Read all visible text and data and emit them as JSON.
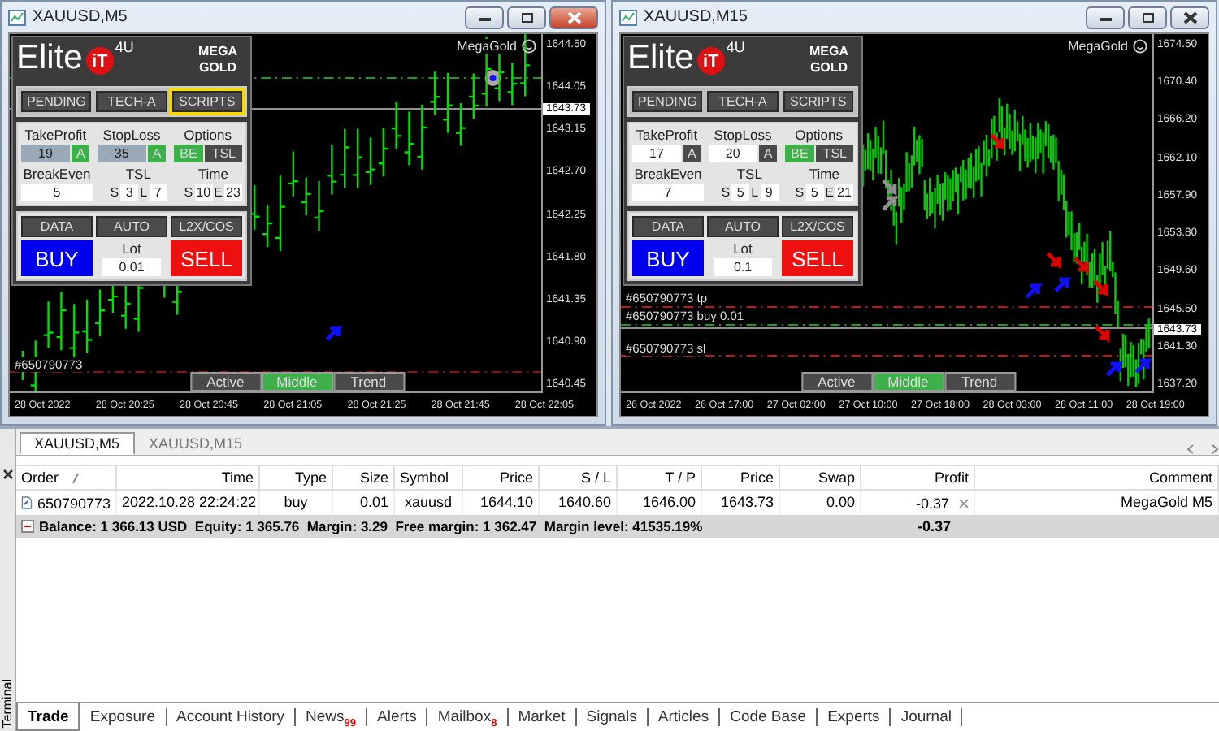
{
  "charts": [
    {
      "title": "XAUUSD,M5",
      "active": true,
      "panel": {
        "logo": {
          "word": "Elite",
          "badge": "iT",
          "suffix": "4U",
          "brand": [
            "MEGA",
            "GOLD"
          ]
        },
        "menu_buttons": [
          {
            "label": "PENDING",
            "highlighted": false
          },
          {
            "label": "TECH-A",
            "highlighted": false
          },
          {
            "label": "SCRIPTS",
            "highlighted": true
          }
        ],
        "take_profit": {
          "label": "TakeProfit",
          "value": "19",
          "auto": "A",
          "auto_on": true
        },
        "stop_loss": {
          "label": "StopLoss",
          "value": "35",
          "auto": "A",
          "auto_on": true
        },
        "options": {
          "label": "Options",
          "buttons": [
            {
              "label": "BE",
              "on": true
            },
            {
              "label": "TSL",
              "on": false
            }
          ]
        },
        "break_even": {
          "label": "BreakEven",
          "value": "5"
        },
        "tsl": {
          "label": "TSL",
          "fields": [
            {
              "prefix": "S",
              "value": "3"
            },
            {
              "prefix": "L",
              "value": "7"
            }
          ]
        },
        "time": {
          "label": "Time",
          "fields": [
            {
              "prefix": "S",
              "value": "10"
            },
            {
              "prefix": "E",
              "value": "23"
            }
          ]
        },
        "tool_buttons": [
          "DATA",
          "AUTO",
          "L2X/COS"
        ],
        "buy": "BUY",
        "lot": {
          "label": "Lot",
          "value": "0.01"
        },
        "sell": "SELL"
      },
      "watermark": "MegaGold",
      "order_lines": [
        {
          "label": "#650790773",
          "kind": "sl"
        }
      ],
      "current_price": "1643.73",
      "price_ticks": [
        "1644.50",
        "1644.05",
        "1643.15",
        "1642.70",
        "1642.25",
        "1641.80",
        "1641.35",
        "1640.90",
        "1640.45"
      ],
      "time_ticks": [
        "28 Oct 2022",
        "28 Oct 20:25",
        "28 Oct 20:45",
        "28 Oct 21:05",
        "28 Oct 21:25",
        "28 Oct 21:45",
        "28 Oct 22:05"
      ],
      "trend_tabs": [
        {
          "label": "Active",
          "selected": false
        },
        {
          "label": "Middle",
          "selected": true
        },
        {
          "label": "Trend",
          "selected": false
        }
      ]
    },
    {
      "title": "XAUUSD,M15",
      "active": false,
      "panel": {
        "logo": {
          "word": "Elite",
          "badge": "iT",
          "suffix": "4U",
          "brand": [
            "MEGA",
            "GOLD"
          ]
        },
        "menu_buttons": [
          {
            "label": "PENDING",
            "highlighted": false
          },
          {
            "label": "TECH-A",
            "highlighted": false
          },
          {
            "label": "SCRIPTS",
            "highlighted": false
          }
        ],
        "take_profit": {
          "label": "TakeProfit",
          "value": "17",
          "auto": "A",
          "auto_on": false
        },
        "stop_loss": {
          "label": "StopLoss",
          "value": "20",
          "auto": "A",
          "auto_on": false
        },
        "options": {
          "label": "Options",
          "buttons": [
            {
              "label": "BE",
              "on": true
            },
            {
              "label": "TSL",
              "on": false
            }
          ]
        },
        "break_even": {
          "label": "BreakEven",
          "value": "7"
        },
        "tsl": {
          "label": "TSL",
          "fields": [
            {
              "prefix": "S",
              "value": "5"
            },
            {
              "prefix": "L",
              "value": "9"
            }
          ]
        },
        "time": {
          "label": "Time",
          "fields": [
            {
              "prefix": "S",
              "value": "5"
            },
            {
              "prefix": "E",
              "value": "21"
            }
          ]
        },
        "tool_buttons": [
          "DATA",
          "AUTO",
          "L2X/COS"
        ],
        "buy": "BUY",
        "lot": {
          "label": "Lot",
          "value": "0.1"
        },
        "sell": "SELL"
      },
      "watermark": "MegaGold",
      "order_lines": [
        {
          "label": "#650790773 tp",
          "kind": "tp"
        },
        {
          "label": "#650790773 buy 0.01",
          "kind": "open"
        },
        {
          "label": "#650790773 sl",
          "kind": "sl"
        }
      ],
      "current_price": "1643.73",
      "price_ticks": [
        "1674.50",
        "1670.40",
        "1666.20",
        "1662.10",
        "1657.90",
        "1653.80",
        "1649.60",
        "1645.50",
        "1641.30",
        "1637.20"
      ],
      "time_ticks": [
        "26 Oct 2022",
        "26 Oct 17:00",
        "27 Oct 02:00",
        "27 Oct 10:00",
        "27 Oct 18:00",
        "28 Oct 03:00",
        "28 Oct 11:00",
        "28 Oct 19:00"
      ],
      "trend_tabs": [
        {
          "label": "Active",
          "selected": false
        },
        {
          "label": "Middle",
          "selected": true
        },
        {
          "label": "Trend",
          "selected": false
        }
      ]
    }
  ],
  "chart_tabs": [
    {
      "label": "XAUUSD,M5",
      "selected": true
    },
    {
      "label": "XAUUSD,M15",
      "selected": false
    }
  ],
  "terminal": {
    "label": "Terminal",
    "columns": [
      "Order",
      "Time",
      "Type",
      "Size",
      "Symbol",
      "Price",
      "S / L",
      "T / P",
      "Price",
      "Swap",
      "Profit",
      "Comment"
    ],
    "rows": [
      {
        "cells": [
          "650790773",
          "2022.10.28 22:24:22",
          "buy",
          "0.01",
          "xauusd",
          "1644.10",
          "1640.60",
          "1646.00",
          "1643.73",
          "0.00",
          "-0.37",
          "MegaGold M5"
        ]
      }
    ],
    "summary": {
      "text": "Balance: 1 366.13 USD  Equity: 1 365.76  Margin: 3.29  Free margin: 1 362.47  Margin level: 41535.19%",
      "profit": "-0.37"
    },
    "tabs": [
      {
        "label": "Trade",
        "selected": true
      },
      {
        "label": "Exposure",
        "selected": false
      },
      {
        "label": "Account History",
        "selected": false
      },
      {
        "label": "News",
        "badge": "99",
        "selected": false
      },
      {
        "label": "Alerts",
        "selected": false
      },
      {
        "label": "Mailbox",
        "badge": "8",
        "selected": false
      },
      {
        "label": "Market",
        "selected": false
      },
      {
        "label": "Signals",
        "selected": false
      },
      {
        "label": "Articles",
        "selected": false
      },
      {
        "label": "Code Base",
        "selected": false
      },
      {
        "label": "Experts",
        "selected": false
      },
      {
        "label": "Journal",
        "selected": false
      }
    ]
  }
}
